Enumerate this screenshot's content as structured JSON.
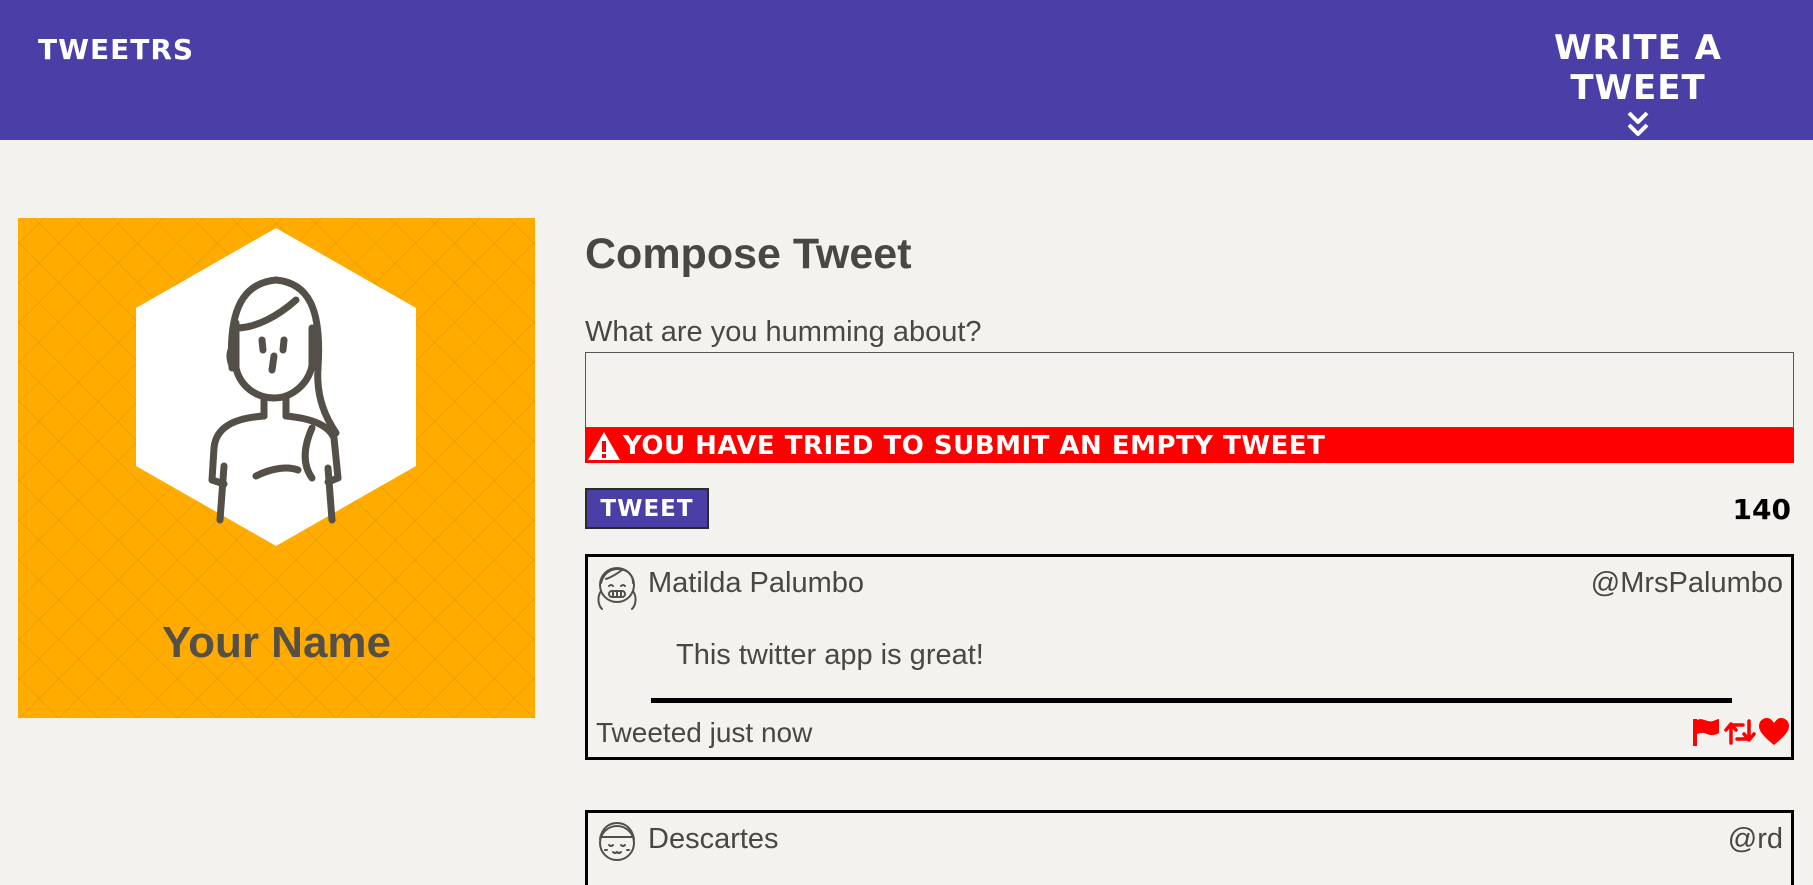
{
  "nav": {
    "brand": "Tweetrs",
    "write_label": "Write a tweet"
  },
  "profile": {
    "name": "Your Name"
  },
  "compose": {
    "title": "Compose Tweet",
    "prompt": "What are you humming about?",
    "input_value": "",
    "error_message": "You have tried to submit an empty tweet",
    "submit_label": "Tweet",
    "char_count": "140"
  },
  "tweets": [
    {
      "name": "Matilda Palumbo",
      "handle": "@MrsPalumbo",
      "content": "This twitter app is great!",
      "time": "Tweeted just now"
    },
    {
      "name": "Descartes",
      "handle": "@rd"
    }
  ],
  "colors": {
    "nav": "#4a3fa6",
    "accent": "#ffab00",
    "error": "#ff0000",
    "background": "#f4f2ee",
    "action_icons": "#ff0000"
  },
  "icons": [
    "double-chevron-down-icon",
    "female-avatar-icon",
    "warning-icon",
    "user-avatar-icon",
    "flag-icon",
    "retweet-icon",
    "heart-icon"
  ]
}
